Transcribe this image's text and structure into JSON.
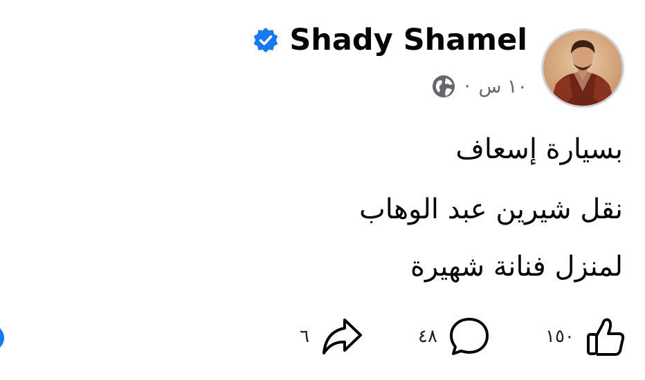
{
  "post": {
    "author": "Shady Shamel",
    "verified": true,
    "time": "١٠ س",
    "separator": "·",
    "privacy_icon": "globe-icon",
    "lines": [
      "بسيارة إسعاف",
      "نقل شيرين عبد الوهاب",
      "لمنزل فنانة شهيرة"
    ]
  },
  "actions": {
    "likes": "١٥٠",
    "comments": "٤٨",
    "shares": "٦",
    "icons": [
      "like-icon",
      "comment-icon",
      "share-icon"
    ]
  },
  "colors": {
    "verified_badge": "#1877f2",
    "text": "#050505",
    "secondary_text": "#65676b",
    "avatar_border": "#cfd2d6"
  }
}
